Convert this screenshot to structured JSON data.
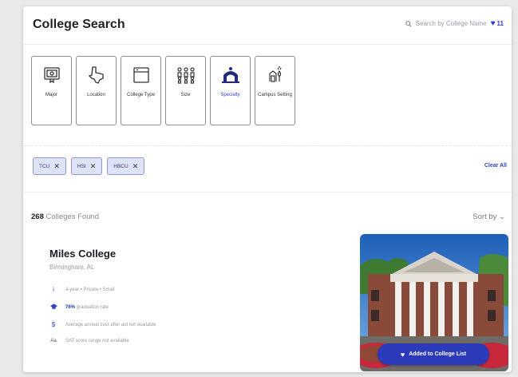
{
  "header": {
    "title": "College Search",
    "search_placeholder": "Search by College Name",
    "saved_count": "11"
  },
  "filters": [
    {
      "label": "Major",
      "icon": "diploma-icon"
    },
    {
      "label": "Location",
      "icon": "texas-map-icon"
    },
    {
      "label": "College Type",
      "icon": "browser-window-icon"
    },
    {
      "label": "Size",
      "icon": "people-group-icon"
    },
    {
      "label": "Specialty",
      "icon": "arch-building-icon",
      "active": true
    },
    {
      "label": "Campus Setting",
      "icon": "campus-trees-icon"
    }
  ],
  "chips": [
    {
      "label": "TCU",
      "close": "✕"
    },
    {
      "label": "HSI",
      "close": "✕"
    },
    {
      "label": "HBCU",
      "close": "✕"
    }
  ],
  "clear_all": "Clear All",
  "results": {
    "count": "268",
    "count_suffix": "Colleges Found",
    "sort_label": "Sort by",
    "sort_chevron": "⌄"
  },
  "college": {
    "name": "Miles College",
    "location": "Birmingham, AL",
    "info": [
      {
        "icon": "info-icon",
        "glyph": "i",
        "text": "4-year • Private • Small"
      },
      {
        "icon": "graduation-cap-icon",
        "glyph": "🎓",
        "bold": "76%",
        "text": "graduation rate"
      },
      {
        "icon": "dollar-icon",
        "glyph": "$",
        "text": "Average annual cost after aid not available"
      },
      {
        "icon": "sat-icon",
        "glyph": "Aa",
        "text": "SAT score range not available"
      }
    ],
    "added_label": "Added to College List"
  },
  "colors": {
    "accent": "#2a3ab8",
    "chip_bg": "#dfe3f8",
    "link": "#3344cc"
  }
}
